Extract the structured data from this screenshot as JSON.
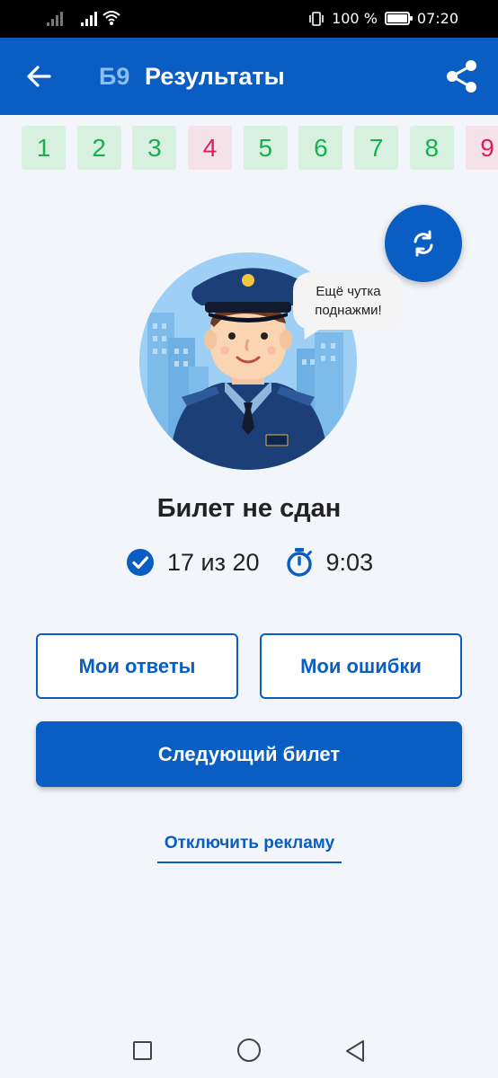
{
  "status_bar": {
    "battery_percent": "100 %",
    "time": "07:20"
  },
  "app_bar": {
    "ticket_code": "Б9",
    "title": "Результаты"
  },
  "tickets": [
    {
      "label": "1",
      "status": "ok"
    },
    {
      "label": "2",
      "status": "ok"
    },
    {
      "label": "3",
      "status": "ok"
    },
    {
      "label": "4",
      "status": "bad"
    },
    {
      "label": "5",
      "status": "ok"
    },
    {
      "label": "6",
      "status": "ok"
    },
    {
      "label": "7",
      "status": "ok"
    },
    {
      "label": "8",
      "status": "ok"
    },
    {
      "label": "9",
      "status": "bad"
    }
  ],
  "bubble": {
    "line1": "Ещё чутка",
    "line2": "поднажми!"
  },
  "result": {
    "title": "Билет не сдан",
    "score": "17 из 20",
    "time": "9:03"
  },
  "buttons": {
    "my_answers": "Мои ответы",
    "my_mistakes": "Мои ошибки",
    "next_ticket": "Следующий билет",
    "disable_ads": "Отключить рекламу"
  },
  "colors": {
    "primary": "#0a5dc2",
    "ok": "#17b050",
    "bad": "#e01b5b"
  }
}
